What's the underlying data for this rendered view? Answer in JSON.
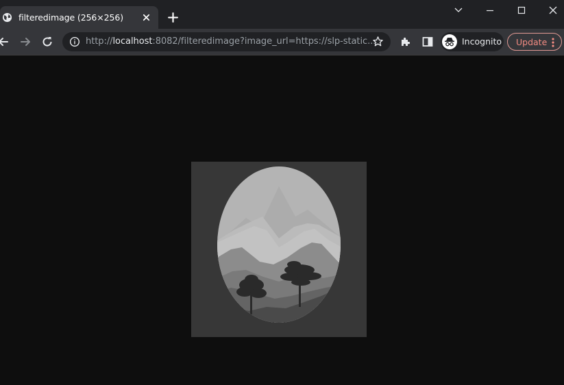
{
  "tab": {
    "title": "filteredimage (256×256)",
    "favicon": "globe-icon",
    "close_icon": "close-icon"
  },
  "new_tab_icon": "plus-icon",
  "window_controls": [
    "chevron-down-icon",
    "minimize-icon",
    "maximize-icon",
    "close-icon"
  ],
  "toolbar": {
    "back_icon": "arrow-left-icon",
    "forward_icon": "arrow-right-icon",
    "reload_icon": "reload-icon",
    "url_scheme": "http://",
    "url_host": "localhost",
    "url_rest": ":8082/filteredimage?image_url=https://slp-static...",
    "info_icon": "info-icon",
    "bookmark_icon": "star-icon",
    "extensions_icon": "puzzle-icon",
    "side_panel_icon": "side-panel-icon",
    "incognito_label": "Incognito",
    "update_label": "Update",
    "menu_icon": "more-vert-icon"
  },
  "colors": {
    "tab_strip": "#202124",
    "toolbar": "#35363a",
    "page_background": "#0e0e0e",
    "update_accent": "#f28b82"
  },
  "content": {
    "image_alt": "Grayscale illustration of mountains and trees inside an oval frame"
  }
}
